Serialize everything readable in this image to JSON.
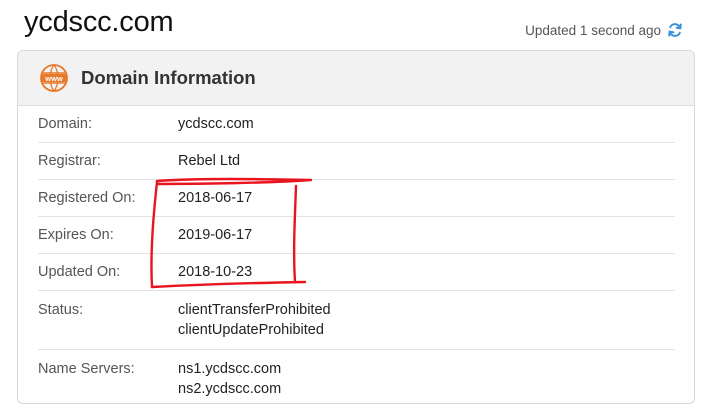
{
  "page": {
    "site_title": "ycdscc.com",
    "updated_text": "Updated 1 second ago"
  },
  "card": {
    "title": "Domain Information",
    "icon_label": "www",
    "rows": [
      {
        "label": "Domain:",
        "values": [
          "ycdscc.com"
        ]
      },
      {
        "label": "Registrar:",
        "values": [
          "Rebel Ltd"
        ]
      },
      {
        "label": "Registered On:",
        "values": [
          "2018-06-17"
        ]
      },
      {
        "label": "Expires On:",
        "values": [
          "2019-06-17"
        ]
      },
      {
        "label": "Updated On:",
        "values": [
          "2018-10-23"
        ]
      },
      {
        "label": "Status:",
        "values": [
          "clientTransferProhibited",
          "clientUpdateProhibited"
        ]
      },
      {
        "label": "Name Servers:",
        "values": [
          "ns1.ycdscc.com",
          "ns2.ycdscc.com"
        ]
      }
    ]
  },
  "icons": {
    "refresh": "refresh-icon",
    "www": "www-globe-icon"
  },
  "colors": {
    "accent_orange": "#e8792b",
    "refresh_blue": "#3b8fd9",
    "annotation_red": "#e8141e",
    "header_bg": "#f2f2f2"
  }
}
